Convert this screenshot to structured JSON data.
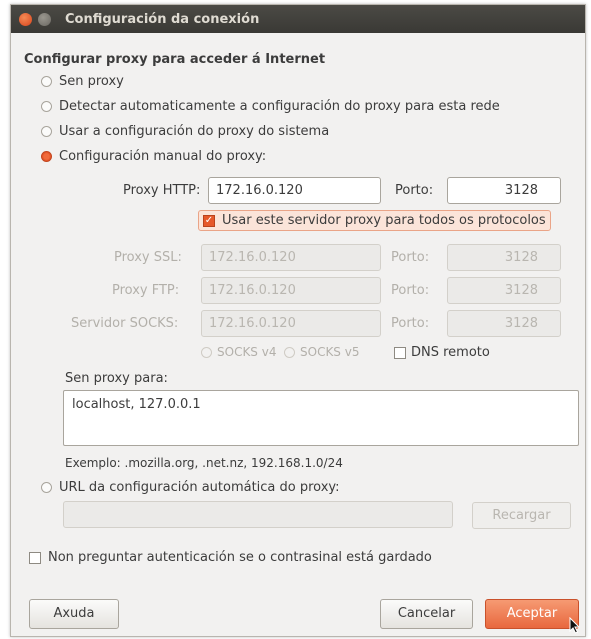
{
  "window": {
    "title": "Configuración da conexión"
  },
  "section": {
    "heading": "Configurar proxy para acceder á Internet"
  },
  "options": {
    "no_proxy": "Sen proxy",
    "auto_detect": "Detectar automaticamente a configuración do proxy para esta rede",
    "system": "Usar a configuración do proxy do sistema",
    "manual": "Configuración manual do proxy:"
  },
  "http": {
    "label": "Proxy HTTP:",
    "host": "172.16.0.120",
    "port_label": "Porto:",
    "port": "3128"
  },
  "use_all": {
    "label": "Usar este servidor proxy para todos os protocolos"
  },
  "ssl": {
    "label": "Proxy SSL:",
    "host": "172.16.0.120",
    "port_label": "Porto:",
    "port": "3128"
  },
  "ftp": {
    "label": "Proxy FTP:",
    "host": "172.16.0.120",
    "port_label": "Porto:",
    "port": "3128"
  },
  "socks": {
    "label": "Servidor SOCKS:",
    "host": "172.16.0.120",
    "port_label": "Porto:",
    "port": "3128"
  },
  "socks_opts": {
    "v4": "SOCKS v4",
    "v5": "SOCKS v5",
    "dns": "DNS remoto"
  },
  "no_proxy_for": {
    "label": "Sen proxy para:",
    "value": "localhost, 127.0.0.1",
    "example": "Exemplo: .mozilla.org, .net.nz, 192.168.1.0/24"
  },
  "auto_url": {
    "label": "URL da configuración automática do proxy:",
    "value": "",
    "reload": "Recargar"
  },
  "no_auth": {
    "label": "Non preguntar autenticación se o contrasinal está gardado"
  },
  "buttons": {
    "help": "Axuda",
    "cancel": "Cancelar",
    "ok": "Aceptar"
  },
  "colors": {
    "accent": "#e6582a",
    "titlebar": "#3c3b37",
    "background": "#f2f1f0"
  }
}
